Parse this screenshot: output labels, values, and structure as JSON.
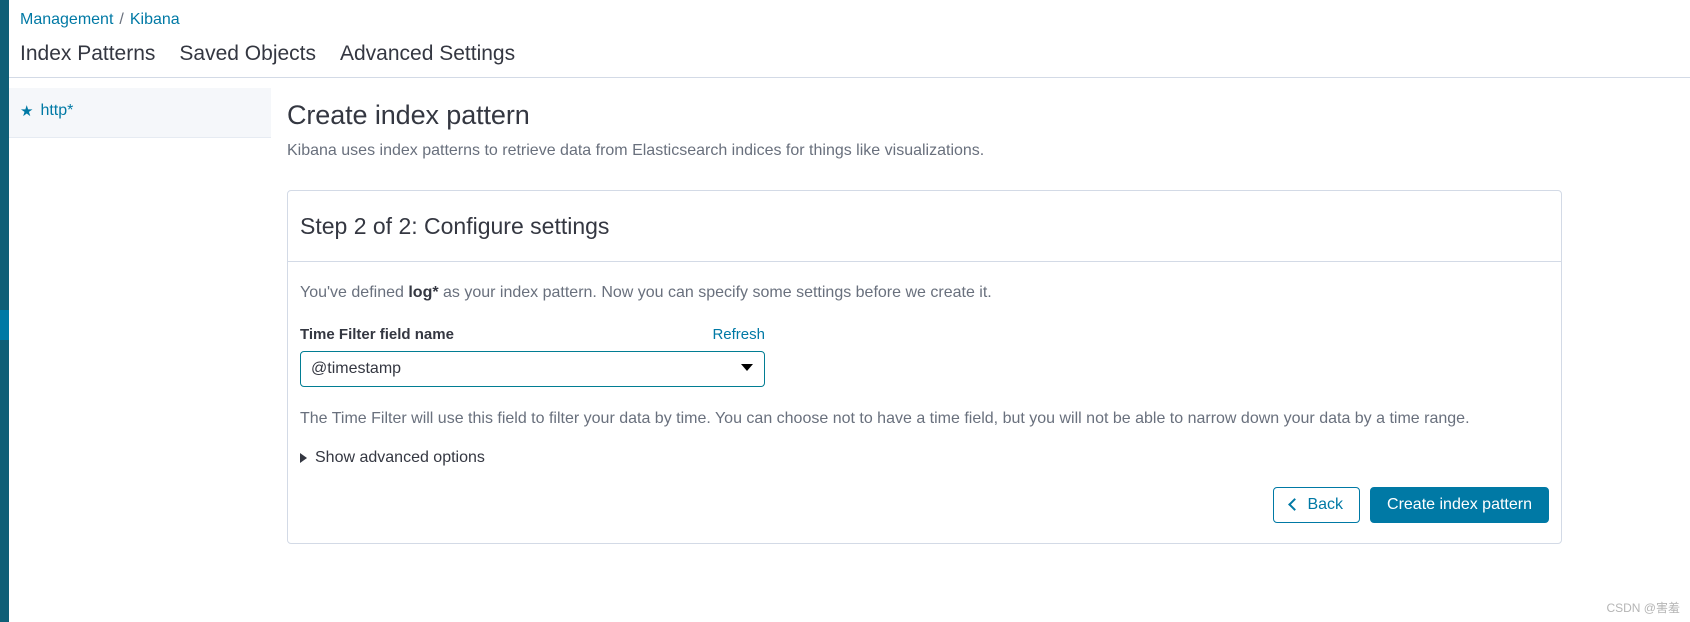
{
  "rail": {
    "accent_color": "#0079a5",
    "base_color": "#0f5f77"
  },
  "breadcrumb": {
    "management": "Management",
    "separator": "/",
    "kibana": "Kibana"
  },
  "tabs": [
    {
      "label": "Index Patterns",
      "name": "tab-index-patterns"
    },
    {
      "label": "Saved Objects",
      "name": "tab-saved-objects"
    },
    {
      "label": "Advanced Settings",
      "name": "tab-advanced-settings"
    }
  ],
  "sidebar": {
    "items": [
      {
        "label": "http*",
        "icon": "star-icon",
        "starred": true
      }
    ]
  },
  "main": {
    "title": "Create index pattern",
    "subtitle": "Kibana uses index patterns to retrieve data from Elasticsearch indices for things like visualizations."
  },
  "panel": {
    "step_title": "Step 2 of 2: Configure settings",
    "intro_prefix": "You've defined ",
    "intro_pattern": "log*",
    "intro_suffix": " as your index pattern. Now you can specify some settings before we create it.",
    "field_label": "Time Filter field name",
    "refresh_label": "Refresh",
    "select_value": "@timestamp",
    "select_options": [
      "@timestamp"
    ],
    "help_text": "The Time Filter will use this field to filter your data by time. You can choose not to have a time field, but you will not be able to narrow down your data by a time range.",
    "advanced_toggle_label": "Show advanced options",
    "back_label": "Back",
    "create_label": "Create index pattern"
  },
  "watermark": {
    "text": "CSDN @害羞"
  },
  "colors": {
    "link": "#0079a5",
    "primary_button": "#0079a5",
    "select_border": "#017d93",
    "muted_text": "#69707d"
  }
}
